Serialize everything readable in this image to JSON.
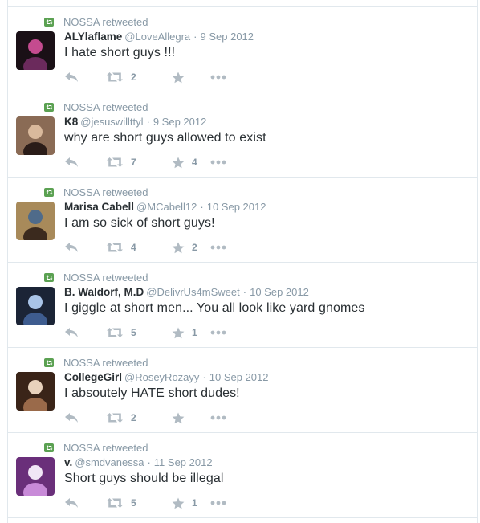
{
  "retweet_label": "NOSSA retweeted",
  "tweets": [
    {
      "fullname": "ALYlaflame",
      "username": "@LoveAllegra",
      "date": "9 Sep 2012",
      "text": "I hate short guys !!!",
      "retweets": "2",
      "favorites": "",
      "avatar_colors": [
        "#1a1016",
        "#6b2a5c",
        "#c44b8f"
      ]
    },
    {
      "fullname": "K8",
      "username": "@jesuswillttyl",
      "date": "9 Sep 2012",
      "text": "why are short guys allowed to exist",
      "retweets": "7",
      "favorites": "4",
      "avatar_colors": [
        "#8a6b55",
        "#2a1c18",
        "#d9b99c"
      ]
    },
    {
      "fullname": "Marisa Cabell",
      "username": "@MCabell12",
      "date": "10 Sep 2012",
      "text": "I am so sick of short guys!",
      "retweets": "4",
      "favorites": "2",
      "avatar_colors": [
        "#a88a5a",
        "#3b2a1e",
        "#4f6b8a"
      ]
    },
    {
      "fullname": "B. Waldorf, M.D",
      "username": "@DelivrUs4mSweet",
      "date": "10 Sep 2012",
      "text": "I giggle at short men... You all look like yard gnomes",
      "retweets": "5",
      "favorites": "1",
      "avatar_colors": [
        "#1b2436",
        "#3e5c8f",
        "#a9c4e8"
      ]
    },
    {
      "fullname": "CollegeGirl",
      "username": "@RoseyRozayy",
      "date": "10 Sep 2012",
      "text": "I absoutely HATE short dudes!",
      "retweets": "2",
      "favorites": "",
      "avatar_colors": [
        "#3a2418",
        "#9a6a4a",
        "#e8d2bc"
      ]
    },
    {
      "fullname": "v.",
      "username": "@smdvanessa",
      "date": "11 Sep 2012",
      "text": "Short guys should be illegal",
      "retweets": "5",
      "favorites": "1",
      "avatar_colors": [
        "#6a2f7a",
        "#c88ad8",
        "#f1e6f6"
      ]
    }
  ]
}
